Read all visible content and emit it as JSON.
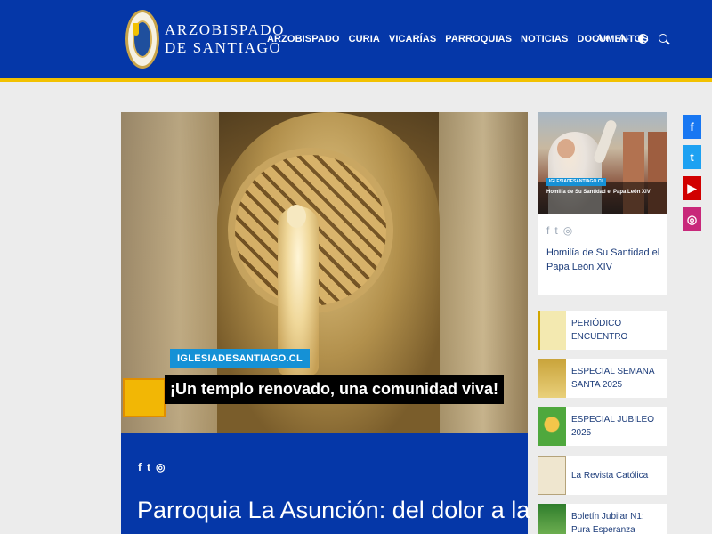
{
  "header": {
    "logo_line1": "Arzobispado",
    "logo_line2": "de Santiago",
    "nav": [
      "ARZOBISPADO",
      "CURIA",
      "VICARÍAS",
      "PARROQUIAS",
      "NOTICIAS",
      "DOCUMENTOS"
    ],
    "font_increase": "A+",
    "font_decrease": "A-"
  },
  "hero": {
    "source_tag": "IGLESIADESANTIAGO.CL",
    "caption": "¡Un templo renovado, una comunidad viva!"
  },
  "article": {
    "share_icons": [
      "facebook-icon",
      "twitter-icon",
      "whatsapp-icon"
    ],
    "title": "Parroquia La Asunción: del dolor a la"
  },
  "featured_card": {
    "image_tag": "IGLESIADESANTIAGO.CL",
    "image_caption": "Homilía de Su Santidad el Papa León XIV",
    "title": "Homilía de Su Santidad el Papa León XIV"
  },
  "sidebar_list": [
    {
      "label": "PERIÓDICO ENCUENTRO",
      "thumb": "periodico"
    },
    {
      "label": "ESPECIAL SEMANA SANTA 2025",
      "thumb": "semana-santa"
    },
    {
      "label": "ESPECIAL JUBILEO 2025",
      "thumb": "jubileo"
    },
    {
      "label": "La Revista Católica",
      "thumb": "revista"
    },
    {
      "label": "Boletín Jubilar N1: Pura Esperanza",
      "thumb": "boletin"
    }
  ],
  "social": [
    {
      "icon": "facebook-icon",
      "glyph": "f",
      "color": "#1877f2"
    },
    {
      "icon": "twitter-icon",
      "glyph": "t",
      "color": "#1da1f2"
    },
    {
      "icon": "youtube-icon",
      "glyph": "▶",
      "color": "#d10000"
    },
    {
      "icon": "instagram-icon",
      "glyph": "◎",
      "color": "#c8287a"
    }
  ],
  "colors": {
    "brand_blue": "#0537a8",
    "accent_yellow": "#f2c100",
    "link_blue": "#1c3c7a"
  }
}
